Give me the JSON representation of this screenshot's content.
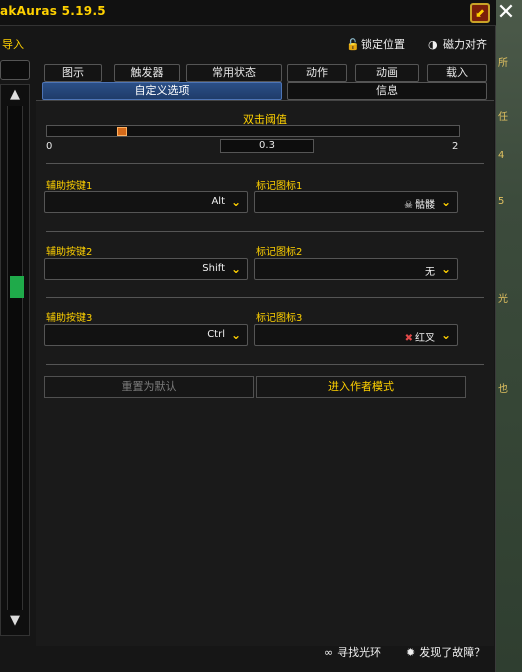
{
  "window": {
    "title": "akAuras 5.19.5"
  },
  "toolbar": {
    "import_label": "导入",
    "lock_label": "锁定位置",
    "magnet_label": "磁力对齐"
  },
  "tabs": {
    "row1": [
      "图示",
      "触发器",
      "常用状态",
      "动作",
      "动画",
      "载入"
    ],
    "row2": [
      "自定义选项",
      "信息"
    ],
    "active": "自定义选项"
  },
  "threshold": {
    "title": "双击阈值",
    "min": "0",
    "max": "2",
    "value": "0.3"
  },
  "rows": [
    {
      "mod_label": "辅助按键1",
      "mod_value": "Alt",
      "mark_label": "标记图标1",
      "mark_value": "骷髅",
      "mark_icon": "skull-icon"
    },
    {
      "mod_label": "辅助按键2",
      "mod_value": "Shift",
      "mark_label": "标记图标2",
      "mark_value": "无",
      "mark_icon": ""
    },
    {
      "mod_label": "辅助按键3",
      "mod_value": "Ctrl",
      "mark_label": "标记图标3",
      "mark_value": "红叉",
      "mark_icon": "red-cross-icon"
    }
  ],
  "buttons": {
    "reset_label": "重置为默认",
    "author_label": "进入作者模式"
  },
  "footer": {
    "find_glow_label": "寻找光环",
    "report_bug_label": "发现了故障？"
  },
  "colors": {
    "accent_gold": "#ffd100",
    "active_tab": "#2b4f86",
    "scroll_thumb": "#1faa4a",
    "slider_thumb": "#d46a1a"
  }
}
